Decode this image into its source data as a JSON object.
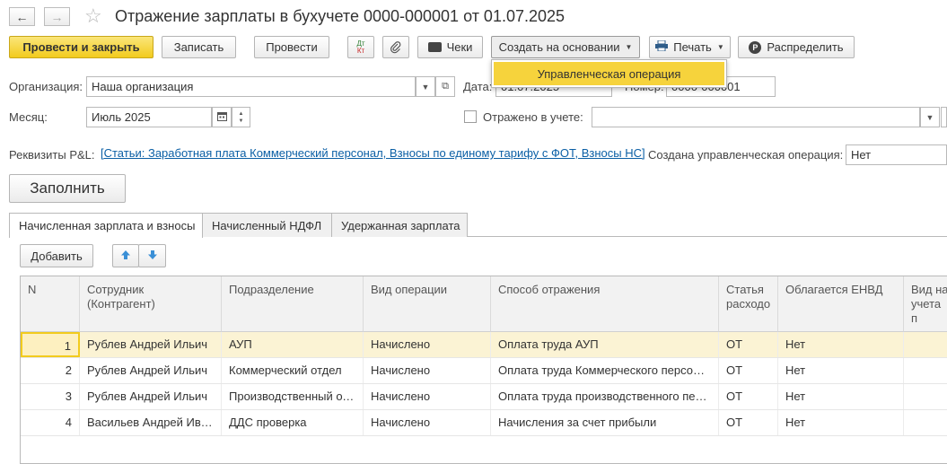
{
  "header": {
    "title": "Отражение зарплаты в бухучете 0000-000001 от 01.07.2025"
  },
  "toolbar": {
    "post_close": "Провести и закрыть",
    "save": "Записать",
    "post": "Провести",
    "dtkt_top": "Дт",
    "dtkt_bottom": "Кт",
    "checks": "Чеки",
    "create_based": "Создать на основании",
    "print": "Печать",
    "distribute": "Распределить"
  },
  "menu": {
    "items": [
      "Управленческая операция"
    ]
  },
  "form": {
    "org_label": "Организация:",
    "org_value": "Наша организация",
    "date_label": "Дата:",
    "date_value": "01.07.2025",
    "number_label": "Номер:",
    "number_value": "0000-000001",
    "month_label": "Месяц:",
    "month_value": "Июль 2025",
    "reflected_label": "Отражено в учете:",
    "reflected_value": "",
    "pl_label": "Реквизиты P&L:",
    "pl_link": "[Статьи: Заработная плата Коммерческий персонал, Взносы по единому тарифу с ФОТ, Взносы НС]",
    "mgmt_op_label": "Создана управленческая операция:",
    "mgmt_op_value": "Нет",
    "fill_button": "Заполнить"
  },
  "tabs": [
    {
      "label": "Начисленная зарплата и взносы"
    },
    {
      "label": "Начисленный НДФЛ"
    },
    {
      "label": "Удержанная зарплата"
    }
  ],
  "table_toolbar": {
    "add": "Добавить"
  },
  "table": {
    "headers": [
      "N",
      "Сотрудник (Контрагент)",
      "Подразделение",
      "Вид операции",
      "Способ отражения",
      "Статья расходо",
      "Облагается ЕНВД",
      "Вид на учета п"
    ],
    "rows": [
      [
        "1",
        "Рублев Андрей Ильич",
        "АУП",
        "Начислено",
        "Оплата труда АУП",
        "ОТ",
        "Нет",
        ""
      ],
      [
        "2",
        "Рублев Андрей Ильич",
        "Коммерческий отдел",
        "Начислено",
        "Оплата труда Коммерческого персонала",
        "ОТ",
        "Нет",
        ""
      ],
      [
        "3",
        "Рублев Андрей Ильич",
        "Производственный отдел",
        "Начислено",
        "Оплата труда производственного персонала",
        "ОТ",
        "Нет",
        ""
      ],
      [
        "4",
        "Васильев Андрей Иванович",
        "ДДС проверка",
        "Начислено",
        "Начисления за счет прибыли",
        "ОТ",
        "Нет",
        ""
      ]
    ]
  },
  "colors": {
    "primary": "#f2cb1d",
    "selected_row": "#fbf3d4",
    "link": "#0b5fa5"
  }
}
